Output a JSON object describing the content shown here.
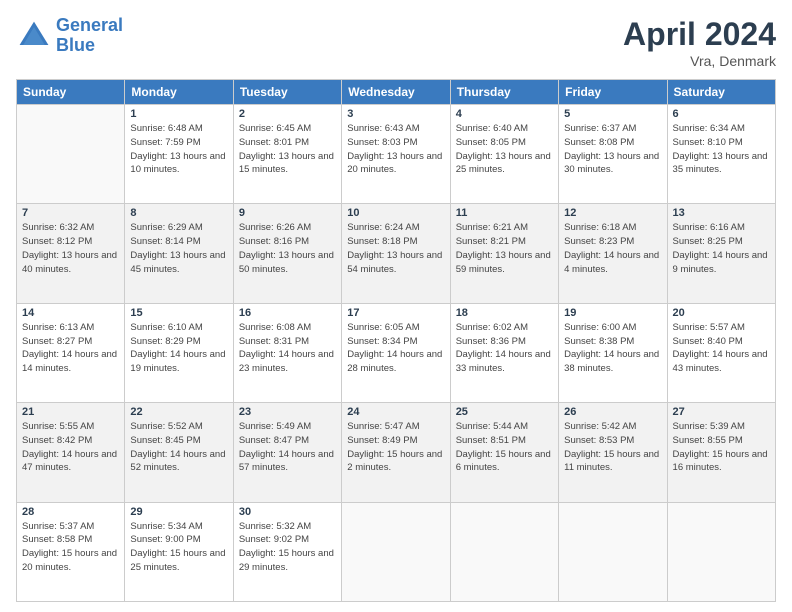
{
  "header": {
    "logo_line1": "General",
    "logo_line2": "Blue",
    "title": "April 2024",
    "subtitle": "Vra, Denmark"
  },
  "days_of_week": [
    "Sunday",
    "Monday",
    "Tuesday",
    "Wednesday",
    "Thursday",
    "Friday",
    "Saturday"
  ],
  "weeks": [
    [
      {
        "num": "",
        "sunrise": "",
        "sunset": "",
        "daylight": ""
      },
      {
        "num": "1",
        "sunrise": "Sunrise: 6:48 AM",
        "sunset": "Sunset: 7:59 PM",
        "daylight": "Daylight: 13 hours and 10 minutes."
      },
      {
        "num": "2",
        "sunrise": "Sunrise: 6:45 AM",
        "sunset": "Sunset: 8:01 PM",
        "daylight": "Daylight: 13 hours and 15 minutes."
      },
      {
        "num": "3",
        "sunrise": "Sunrise: 6:43 AM",
        "sunset": "Sunset: 8:03 PM",
        "daylight": "Daylight: 13 hours and 20 minutes."
      },
      {
        "num": "4",
        "sunrise": "Sunrise: 6:40 AM",
        "sunset": "Sunset: 8:05 PM",
        "daylight": "Daylight: 13 hours and 25 minutes."
      },
      {
        "num": "5",
        "sunrise": "Sunrise: 6:37 AM",
        "sunset": "Sunset: 8:08 PM",
        "daylight": "Daylight: 13 hours and 30 minutes."
      },
      {
        "num": "6",
        "sunrise": "Sunrise: 6:34 AM",
        "sunset": "Sunset: 8:10 PM",
        "daylight": "Daylight: 13 hours and 35 minutes."
      }
    ],
    [
      {
        "num": "7",
        "sunrise": "Sunrise: 6:32 AM",
        "sunset": "Sunset: 8:12 PM",
        "daylight": "Daylight: 13 hours and 40 minutes."
      },
      {
        "num": "8",
        "sunrise": "Sunrise: 6:29 AM",
        "sunset": "Sunset: 8:14 PM",
        "daylight": "Daylight: 13 hours and 45 minutes."
      },
      {
        "num": "9",
        "sunrise": "Sunrise: 6:26 AM",
        "sunset": "Sunset: 8:16 PM",
        "daylight": "Daylight: 13 hours and 50 minutes."
      },
      {
        "num": "10",
        "sunrise": "Sunrise: 6:24 AM",
        "sunset": "Sunset: 8:18 PM",
        "daylight": "Daylight: 13 hours and 54 minutes."
      },
      {
        "num": "11",
        "sunrise": "Sunrise: 6:21 AM",
        "sunset": "Sunset: 8:21 PM",
        "daylight": "Daylight: 13 hours and 59 minutes."
      },
      {
        "num": "12",
        "sunrise": "Sunrise: 6:18 AM",
        "sunset": "Sunset: 8:23 PM",
        "daylight": "Daylight: 14 hours and 4 minutes."
      },
      {
        "num": "13",
        "sunrise": "Sunrise: 6:16 AM",
        "sunset": "Sunset: 8:25 PM",
        "daylight": "Daylight: 14 hours and 9 minutes."
      }
    ],
    [
      {
        "num": "14",
        "sunrise": "Sunrise: 6:13 AM",
        "sunset": "Sunset: 8:27 PM",
        "daylight": "Daylight: 14 hours and 14 minutes."
      },
      {
        "num": "15",
        "sunrise": "Sunrise: 6:10 AM",
        "sunset": "Sunset: 8:29 PM",
        "daylight": "Daylight: 14 hours and 19 minutes."
      },
      {
        "num": "16",
        "sunrise": "Sunrise: 6:08 AM",
        "sunset": "Sunset: 8:31 PM",
        "daylight": "Daylight: 14 hours and 23 minutes."
      },
      {
        "num": "17",
        "sunrise": "Sunrise: 6:05 AM",
        "sunset": "Sunset: 8:34 PM",
        "daylight": "Daylight: 14 hours and 28 minutes."
      },
      {
        "num": "18",
        "sunrise": "Sunrise: 6:02 AM",
        "sunset": "Sunset: 8:36 PM",
        "daylight": "Daylight: 14 hours and 33 minutes."
      },
      {
        "num": "19",
        "sunrise": "Sunrise: 6:00 AM",
        "sunset": "Sunset: 8:38 PM",
        "daylight": "Daylight: 14 hours and 38 minutes."
      },
      {
        "num": "20",
        "sunrise": "Sunrise: 5:57 AM",
        "sunset": "Sunset: 8:40 PM",
        "daylight": "Daylight: 14 hours and 43 minutes."
      }
    ],
    [
      {
        "num": "21",
        "sunrise": "Sunrise: 5:55 AM",
        "sunset": "Sunset: 8:42 PM",
        "daylight": "Daylight: 14 hours and 47 minutes."
      },
      {
        "num": "22",
        "sunrise": "Sunrise: 5:52 AM",
        "sunset": "Sunset: 8:45 PM",
        "daylight": "Daylight: 14 hours and 52 minutes."
      },
      {
        "num": "23",
        "sunrise": "Sunrise: 5:49 AM",
        "sunset": "Sunset: 8:47 PM",
        "daylight": "Daylight: 14 hours and 57 minutes."
      },
      {
        "num": "24",
        "sunrise": "Sunrise: 5:47 AM",
        "sunset": "Sunset: 8:49 PM",
        "daylight": "Daylight: 15 hours and 2 minutes."
      },
      {
        "num": "25",
        "sunrise": "Sunrise: 5:44 AM",
        "sunset": "Sunset: 8:51 PM",
        "daylight": "Daylight: 15 hours and 6 minutes."
      },
      {
        "num": "26",
        "sunrise": "Sunrise: 5:42 AM",
        "sunset": "Sunset: 8:53 PM",
        "daylight": "Daylight: 15 hours and 11 minutes."
      },
      {
        "num": "27",
        "sunrise": "Sunrise: 5:39 AM",
        "sunset": "Sunset: 8:55 PM",
        "daylight": "Daylight: 15 hours and 16 minutes."
      }
    ],
    [
      {
        "num": "28",
        "sunrise": "Sunrise: 5:37 AM",
        "sunset": "Sunset: 8:58 PM",
        "daylight": "Daylight: 15 hours and 20 minutes."
      },
      {
        "num": "29",
        "sunrise": "Sunrise: 5:34 AM",
        "sunset": "Sunset: 9:00 PM",
        "daylight": "Daylight: 15 hours and 25 minutes."
      },
      {
        "num": "30",
        "sunrise": "Sunrise: 5:32 AM",
        "sunset": "Sunset: 9:02 PM",
        "daylight": "Daylight: 15 hours and 29 minutes."
      },
      {
        "num": "",
        "sunrise": "",
        "sunset": "",
        "daylight": ""
      },
      {
        "num": "",
        "sunrise": "",
        "sunset": "",
        "daylight": ""
      },
      {
        "num": "",
        "sunrise": "",
        "sunset": "",
        "daylight": ""
      },
      {
        "num": "",
        "sunrise": "",
        "sunset": "",
        "daylight": ""
      }
    ]
  ]
}
